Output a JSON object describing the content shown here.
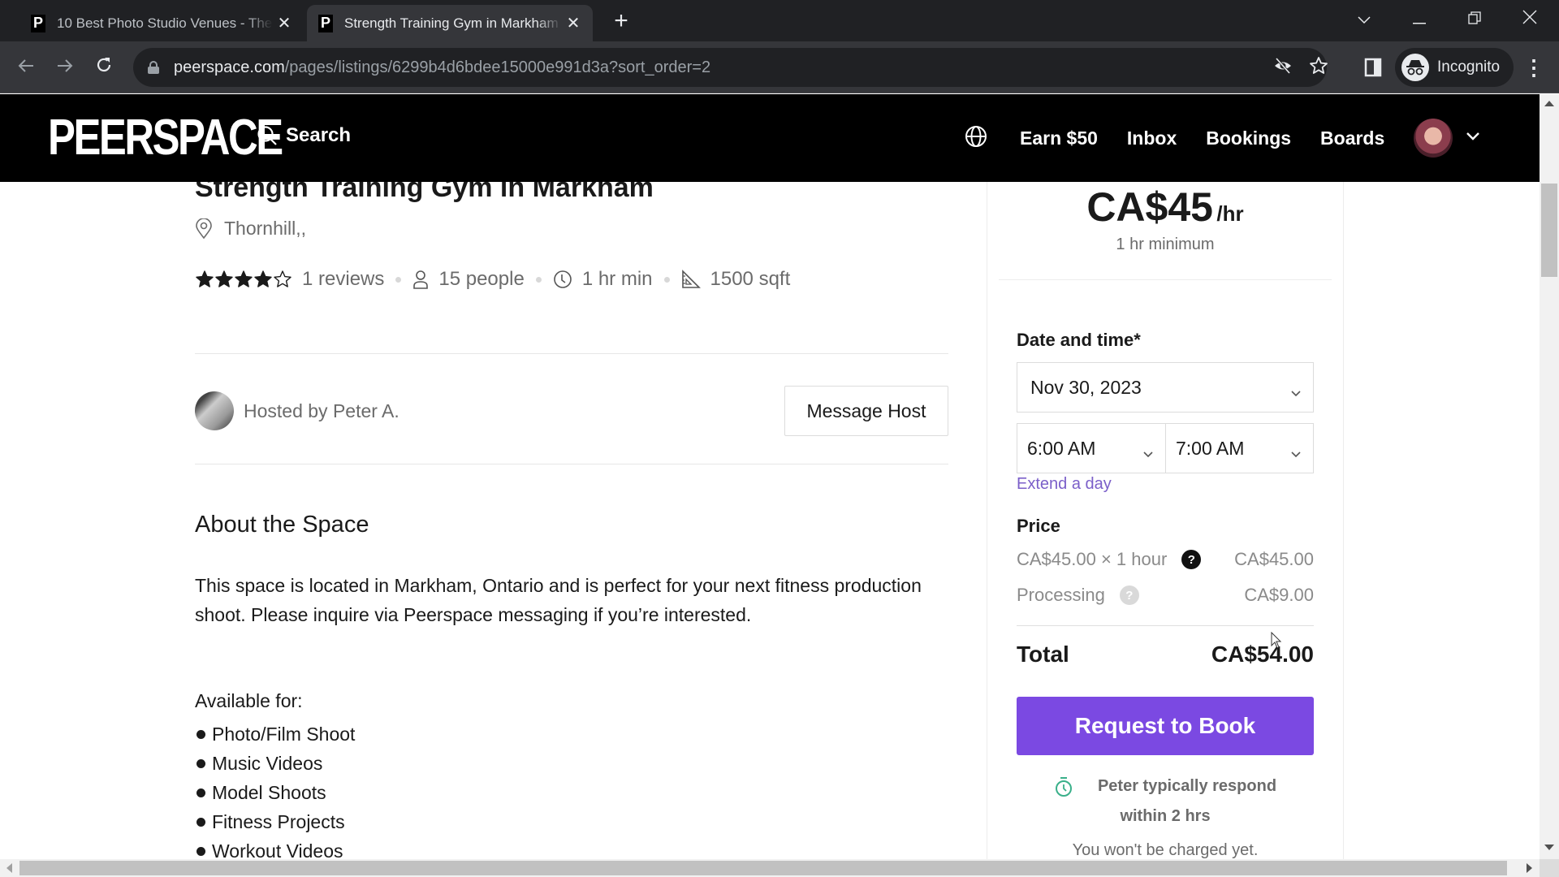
{
  "browser": {
    "tabs": [
      {
        "title": "10 Best Photo Studio Venues - The",
        "favicon": "P",
        "active": false
      },
      {
        "title": "Strength Training Gym in Markham",
        "favicon": "P",
        "active": true
      }
    ],
    "new_tab_label": "+",
    "url_host": "peerspace.com",
    "url_path": "/pages/listings/6299b4d6bdee15000e991d3a?sort_order=2",
    "profile_label": "Incognito",
    "icons": [
      "back-icon",
      "forward-icon",
      "reload-icon",
      "lock-icon",
      "eye-off-icon",
      "star-icon",
      "side-panel-icon",
      "incognito-icon",
      "menu-icon",
      "tab-search-icon",
      "minimize-icon",
      "restore-icon",
      "close-icon"
    ]
  },
  "header": {
    "logo": "PEERSPACE",
    "search_label": "Search",
    "nav": [
      "Earn $50",
      "Inbox",
      "Bookings",
      "Boards"
    ]
  },
  "listing": {
    "title": "Strength Training Gym in Markham",
    "location": "Thornhill,,",
    "rating": 4,
    "rating_max": 5,
    "reviews": "1 reviews",
    "capacity": "15 people",
    "min_hours": "1 hr min",
    "size": "1500 sqft",
    "host_text": "Hosted by Peter A.",
    "message_host_label": "Message Host",
    "about_title": "About the Space",
    "about_text": "This space is located in Markham, Ontario and is perfect for your next fitness production shoot. Please inquire via Peerspace messaging if you’re interested.",
    "available_label": "Available for:",
    "available_for": [
      "Photo/Film Shoot",
      "Music Videos",
      "Model Shoots",
      "Fitness Projects",
      "Workout Videos"
    ]
  },
  "booking": {
    "price": "CA$45",
    "price_unit": "/hr",
    "minimum": "1 hr minimum",
    "date_time_label": "Date and time*",
    "date": "Nov 30, 2023",
    "start_time": "6:00 AM",
    "end_time": "7:00 AM",
    "extend_label": "Extend a day",
    "price_label": "Price",
    "line_items": [
      {
        "label": "CA$45.00 × 1 hour",
        "value": "CA$45.00"
      },
      {
        "label": "Processing",
        "value": "CA$9.00"
      }
    ],
    "total_label": "Total",
    "total_value": "CA$54.00",
    "request_label": "Request to Book",
    "respond_line1": "Peter typically respond",
    "respond_line2": "within 2 hrs",
    "no_charge": "You won't be charged yet.",
    "accent_color": "#7b49e2",
    "link_color": "#7b5fc9"
  }
}
